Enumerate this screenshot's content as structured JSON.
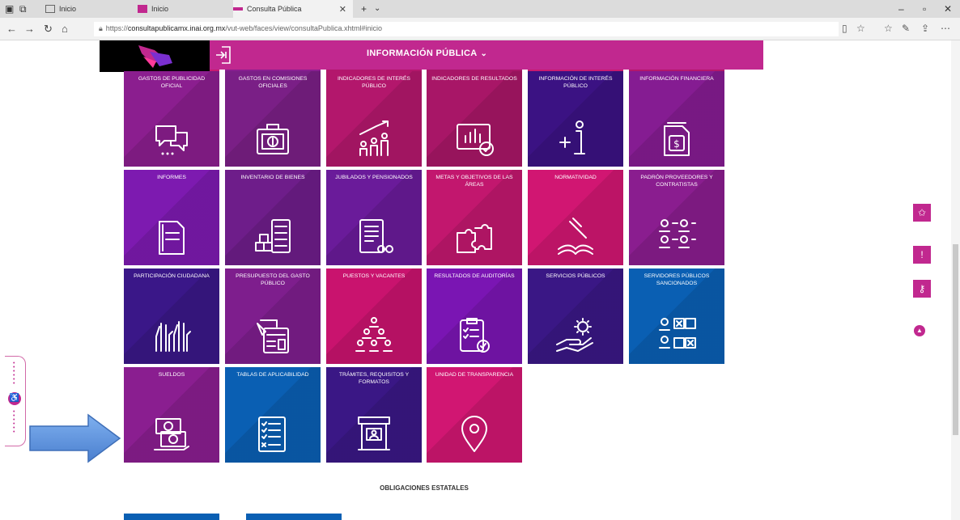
{
  "browser": {
    "tabs": [
      {
        "label": "Inicio"
      },
      {
        "label": "Inicio"
      },
      {
        "label": "Consulta Pública",
        "active": true
      }
    ],
    "url_prefix": "https://",
    "url_host": "consultapublicamx.inai.org.mx",
    "url_path": "/vut-web/faces/view/consultaPublica.xhtml#inicio"
  },
  "header": {
    "menu_label": "INFORMACIÓN PÚBLICA"
  },
  "tiles": [
    {
      "label": "GASTOS DE PUBLICIDAD OFICIAL",
      "color": "#8b1e8f",
      "icon": "speech-bubbles-icon"
    },
    {
      "label": "GASTOS EN COMISIONES OFICIALES",
      "color": "#7a1f86",
      "icon": "briefcase-money-icon"
    },
    {
      "label": "INDICADORES DE INTERÉS PÚBLICO",
      "color": "#b3176c",
      "icon": "people-growth-icon"
    },
    {
      "label": "INDICADORES DE RESULTADOS",
      "color": "#a81667",
      "icon": "monitor-chart-icon"
    },
    {
      "label": "INFORMACIÓN DE INTERÉS PÚBLICO",
      "color": "#3b1283",
      "icon": "info-plus-icon"
    },
    {
      "label": "INFORMACIÓN FINANCIERA",
      "color": "#851c92",
      "icon": "document-money-icon"
    },
    {
      "label": "INFORMES",
      "color": "#7d1ab0",
      "icon": "report-icon"
    },
    {
      "label": "INVENTARIO DE BIENES",
      "color": "#6e1d8a",
      "icon": "inventory-icon"
    },
    {
      "label": "JUBILADOS Y PENSIONADOS",
      "color": "#6a1b9a",
      "icon": "pension-list-icon"
    },
    {
      "label": "METAS Y OBJETIVOS DE LAS ÁREAS",
      "color": "#c2176e",
      "icon": "puzzle-icon"
    },
    {
      "label": "NORMATIVIDAD",
      "color": "#d11672",
      "icon": "gavel-book-icon"
    },
    {
      "label": "PADRÓN PROVEEDORES Y CONTRATISTAS",
      "color": "#8a1d8f",
      "icon": "suppliers-icon"
    },
    {
      "label": "PARTICIPACIÓN CIUDADANA",
      "color": "#3a1788",
      "icon": "raised-hands-icon"
    },
    {
      "label": "PRESUPUESTO DEL GASTO PÚBLICO",
      "color": "#7e1e8d",
      "icon": "budget-calculator-icon"
    },
    {
      "label": "PUESTOS Y VACANTES",
      "color": "#c9136e",
      "icon": "organization-icon"
    },
    {
      "label": "RESULTADOS DE AUDITORÍAS",
      "color": "#7a15b3",
      "icon": "audit-clipboard-icon"
    },
    {
      "label": "SERVICIOS PÚBLICOS",
      "color": "#3a1785",
      "icon": "hand-gear-icon"
    },
    {
      "label": "SERVIDORES PÚBLICOS SANCIONADOS",
      "color": "#0a5fb3",
      "icon": "sanctioned-icon"
    },
    {
      "label": "SUELDOS",
      "color": "#8a1e90",
      "icon": "salary-icon"
    },
    {
      "label": "TABLAS DE APLICABILIDAD",
      "color": "#0a5fb3",
      "icon": "checklist-icon"
    },
    {
      "label": "TRÁMITES, REQUISITOS Y FORMATOS",
      "color": "#3a1785",
      "icon": "kiosk-icon"
    },
    {
      "label": "UNIDAD DE TRANSPARENCIA",
      "color": "#d11672",
      "icon": "location-pin-icon"
    }
  ],
  "partial_row_colors": [
    "#c81a70",
    "#8a1e90",
    "#b3176c",
    "#a81667",
    "#c81a70",
    "#b3176c"
  ],
  "section": {
    "obligaciones_label": "OBLIGACIONES ESTATALES"
  },
  "colors": {
    "brand": "#c1288f",
    "arrow": "#6a9be0"
  }
}
